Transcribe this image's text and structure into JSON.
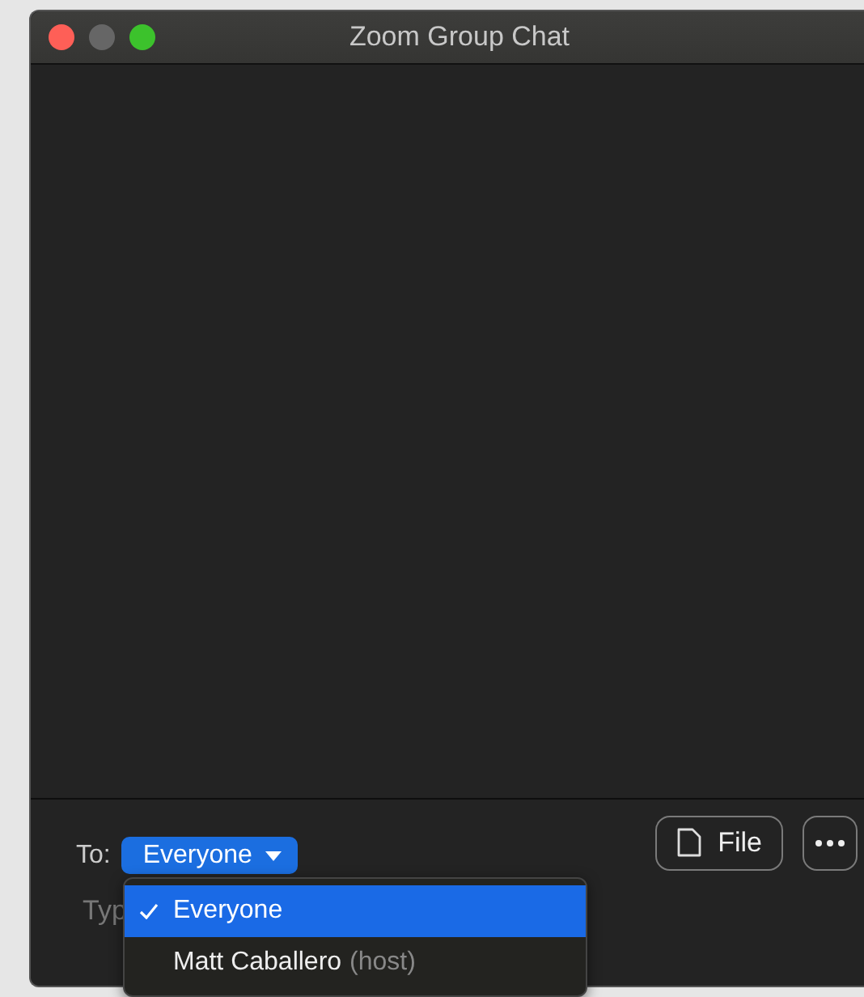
{
  "window": {
    "title": "Zoom Group Chat"
  },
  "recipient": {
    "label": "To:",
    "value": "Everyone"
  },
  "buttons": [
    {
      "kind": "file",
      "label": "File"
    },
    {
      "kind": "more"
    }
  ],
  "message": {
    "placeholder": "Typ"
  },
  "menu": {
    "items": [
      {
        "name": "Everyone",
        "selected": true
      },
      {
        "name": "Matt Caballero",
        "role": "(host)",
        "selected": false
      }
    ]
  }
}
